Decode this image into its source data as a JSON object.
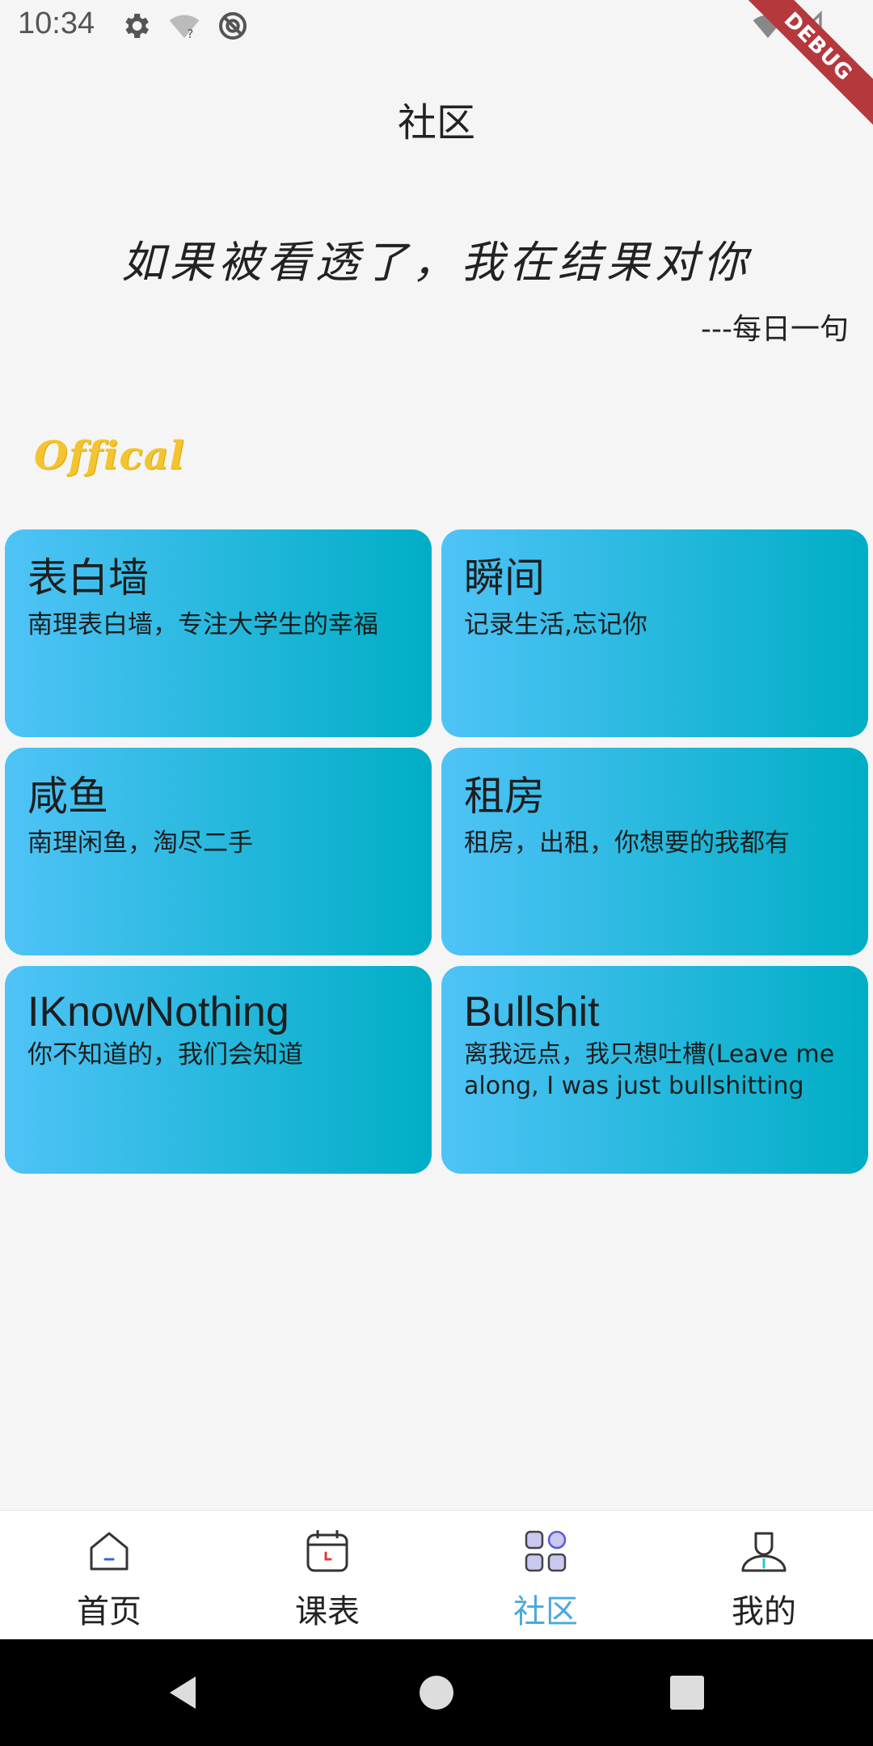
{
  "status_bar": {
    "time": "10:34",
    "debug_label": "DEBUG"
  },
  "page": {
    "title": "社区"
  },
  "quote": {
    "text": "如果被看透了，我在结果对你",
    "source": "---每日一句"
  },
  "section": {
    "label": "Offical"
  },
  "cards": [
    {
      "title": "表白墙",
      "desc": "南理表白墙，专注大学生的幸福"
    },
    {
      "title": "瞬间",
      "desc": "记录生活,忘记你"
    },
    {
      "title": "咸鱼",
      "desc": "南理闲鱼，淘尽二手"
    },
    {
      "title": "租房",
      "desc": "租房，出租，你想要的我都有"
    },
    {
      "title": "IKnowNothing",
      "desc": "你不知道的，我们会知道"
    },
    {
      "title": "Bullshit",
      "desc": "离我远点，我只想吐槽(Leave me along, I was just bullshitting"
    }
  ],
  "bottom_nav": {
    "items": [
      {
        "label": "首页",
        "icon": "home-icon"
      },
      {
        "label": "课表",
        "icon": "calendar-icon"
      },
      {
        "label": "社区",
        "icon": "community-grid-icon",
        "active": true
      },
      {
        "label": "我的",
        "icon": "profile-icon"
      }
    ]
  },
  "colors": {
    "card_gradient_start": "#4fc3f7",
    "card_gradient_end": "#00aec5",
    "active_nav": "#4aa8e0",
    "offical_yellow": "#f4c430",
    "debug_ribbon": "#b5383c"
  }
}
